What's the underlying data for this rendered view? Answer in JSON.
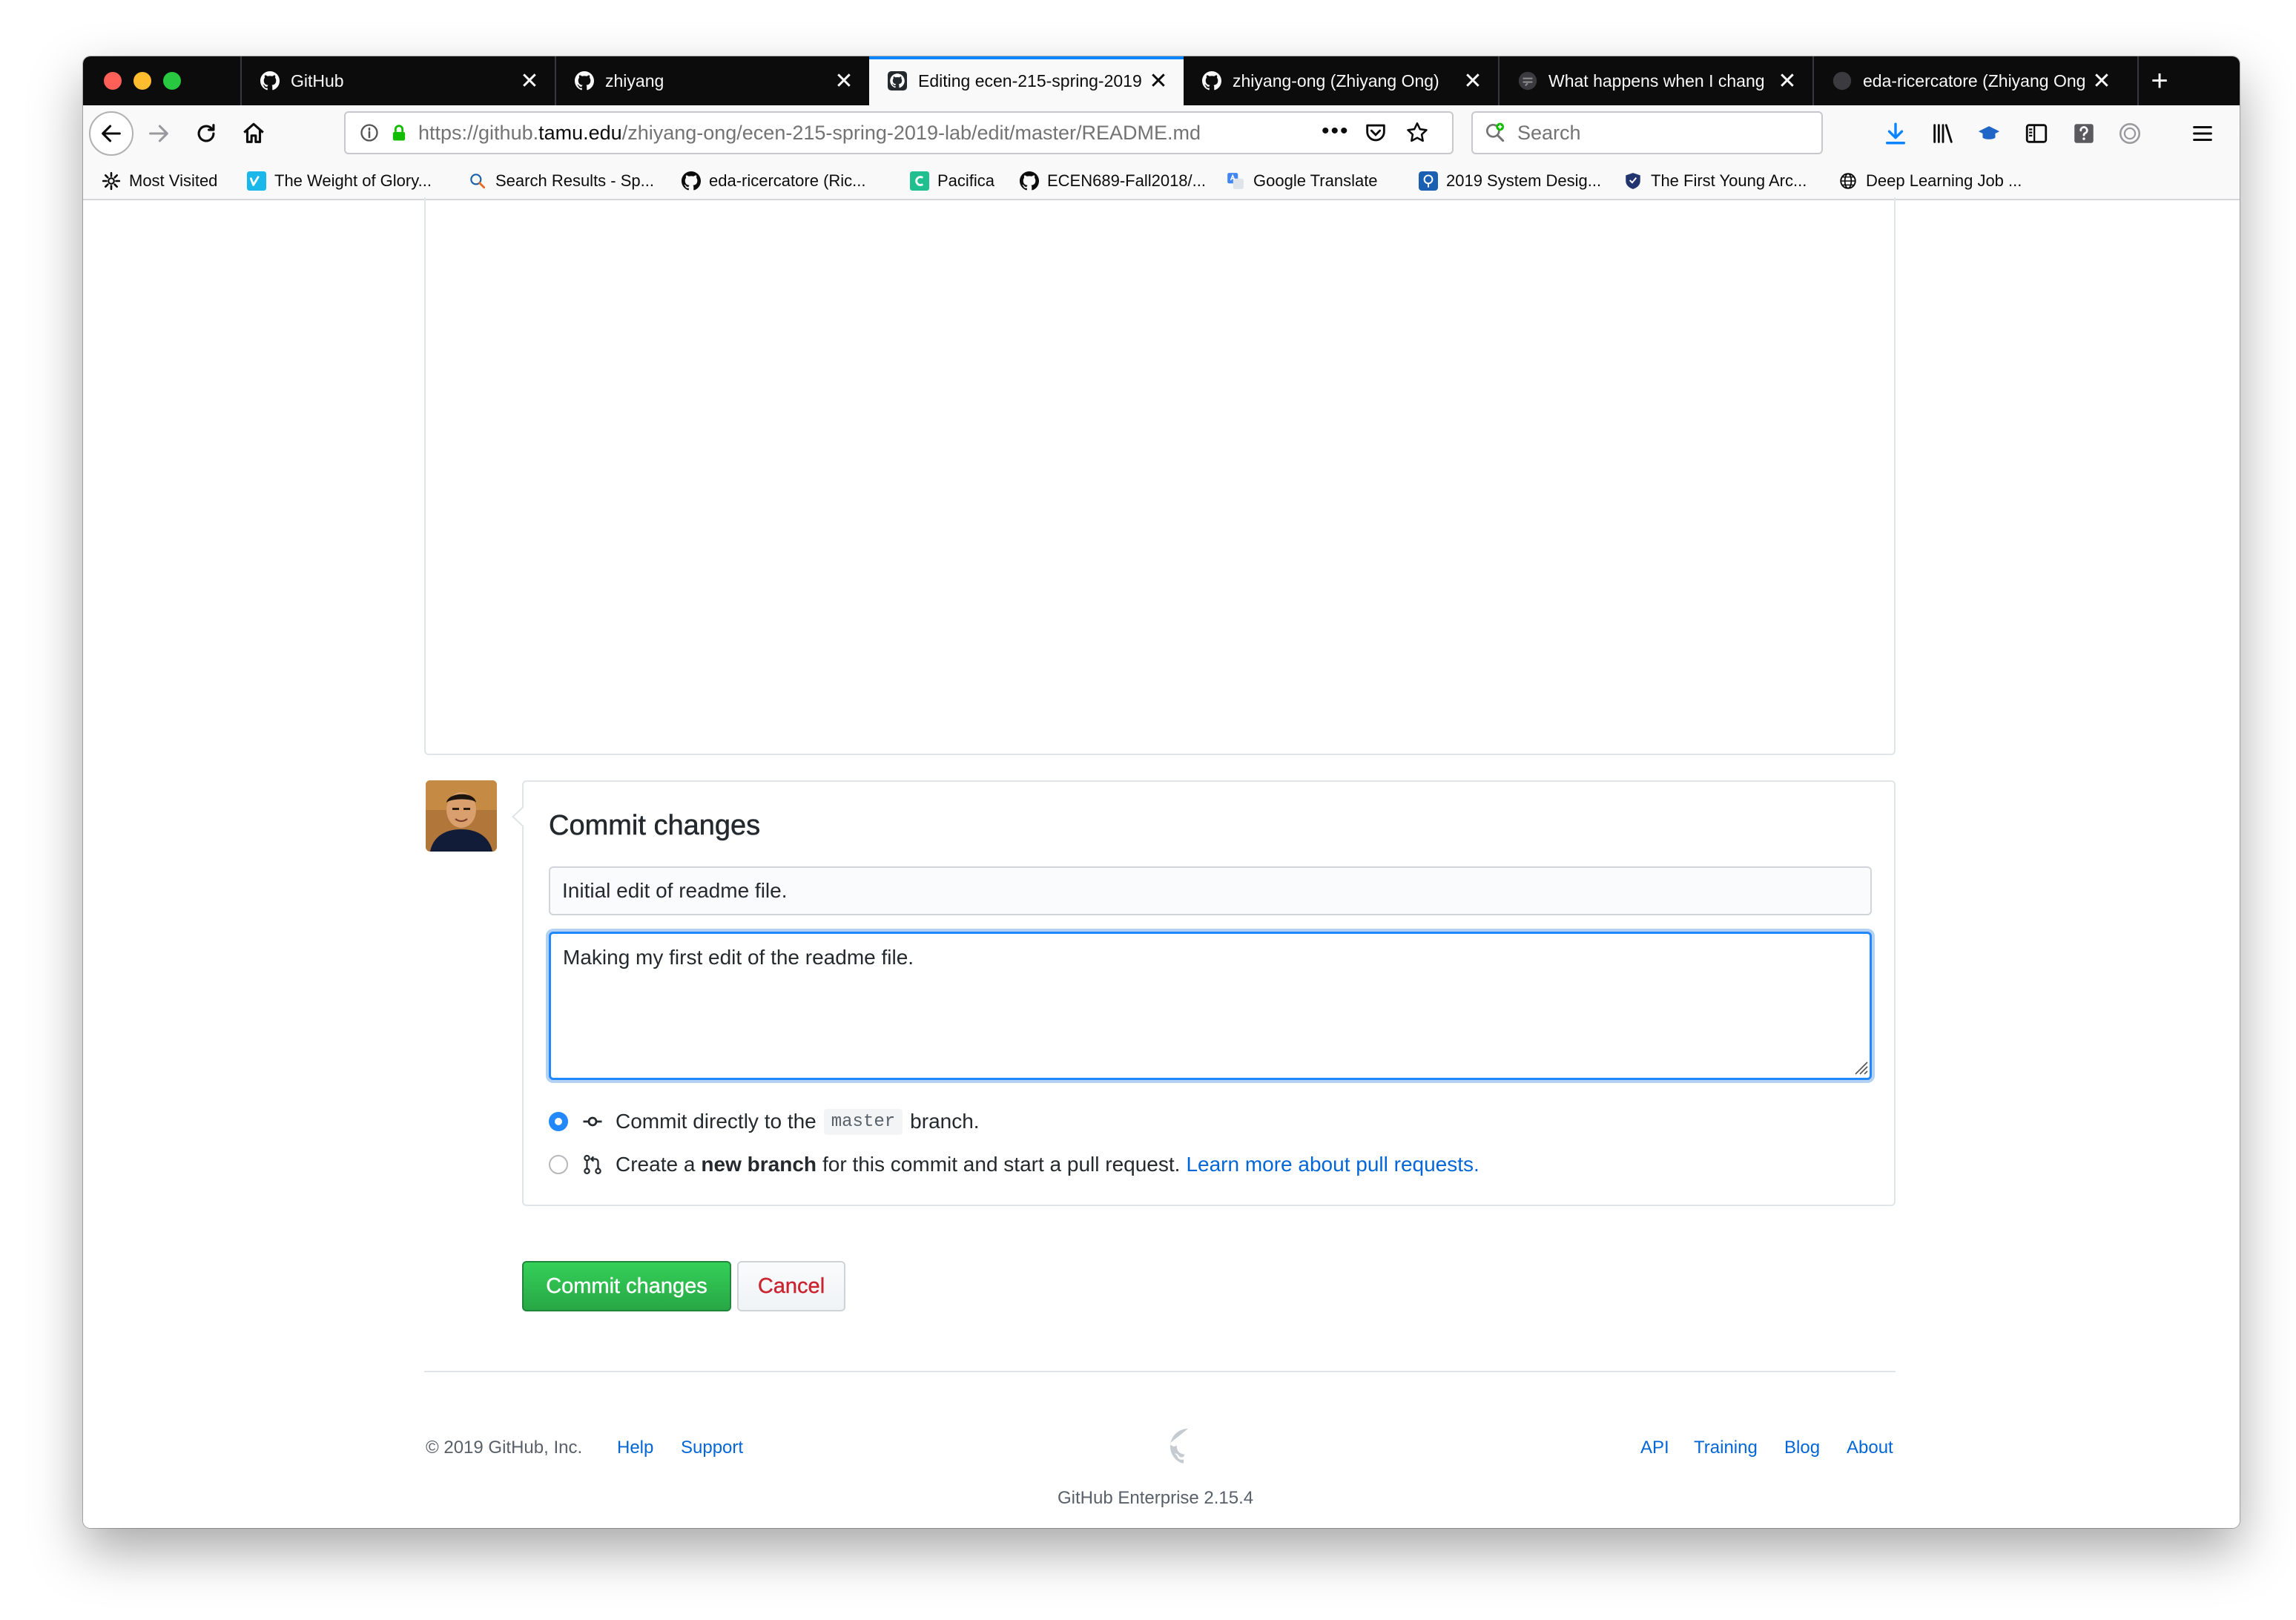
{
  "browser": {
    "tabs": [
      {
        "title": "GitHub",
        "active": false
      },
      {
        "title": "zhiyang",
        "active": false
      },
      {
        "title": "Editing ecen-215-spring-2019",
        "active": true
      },
      {
        "title": "zhiyang-ong (Zhiyang Ong)",
        "active": false
      },
      {
        "title": "What happens when I chang",
        "active": false
      },
      {
        "title": "eda-ricercatore (Zhiyang Ong",
        "active": false
      }
    ],
    "url_prefix": "https://github.",
    "url_domain": "tamu.edu",
    "url_path": "/zhiyang-ong/ecen-215-spring-2019-lab/edit/master/README.md",
    "search_placeholder": "Search",
    "bookmarks": [
      {
        "label": "Most Visited",
        "icon": "gear-icon"
      },
      {
        "label": "The Weight of Glory...",
        "icon": "vimeo-icon"
      },
      {
        "label": "Search Results - Sp...",
        "icon": "search-results-icon"
      },
      {
        "label": "eda-ricercatore (Ric...",
        "icon": "github-icon"
      },
      {
        "label": "Pacifica",
        "icon": "pacifica-icon"
      },
      {
        "label": "ECEN689-Fall2018/...",
        "icon": "github-icon"
      },
      {
        "label": "Google Translate",
        "icon": "translate-icon"
      },
      {
        "label": "2019 System Desig...",
        "icon": "conference-icon"
      },
      {
        "label": "The First Young Arc...",
        "icon": "shield-icon"
      },
      {
        "label": "Deep Learning Job ...",
        "icon": "globe-icon"
      }
    ]
  },
  "commit": {
    "title": "Commit changes",
    "summary_value": "Initial edit of readme file.",
    "description_value": "Making my first edit of the readme file.",
    "option_direct_prefix": "Commit directly to the",
    "option_direct_branch": "master",
    "option_direct_suffix": "branch.",
    "option_new_prefix": "Create a",
    "option_new_bold": "new branch",
    "option_new_suffix": "for this commit and start a pull request.",
    "option_new_link": "Learn more about pull requests.",
    "commit_button": "Commit changes",
    "cancel_button": "Cancel"
  },
  "footer": {
    "copyright": "© 2019 GitHub, Inc.",
    "help": "Help",
    "support": "Support",
    "api": "API",
    "training": "Training",
    "blog": "Blog",
    "about": "About",
    "version": "GitHub Enterprise 2.15.4"
  },
  "colors": {
    "accent_blue": "#0366d6",
    "focus_blue": "#2188ff",
    "commit_green": "#28a745",
    "cancel_red": "#cb2431",
    "tabstrip_dark": "#0c0c0d"
  }
}
